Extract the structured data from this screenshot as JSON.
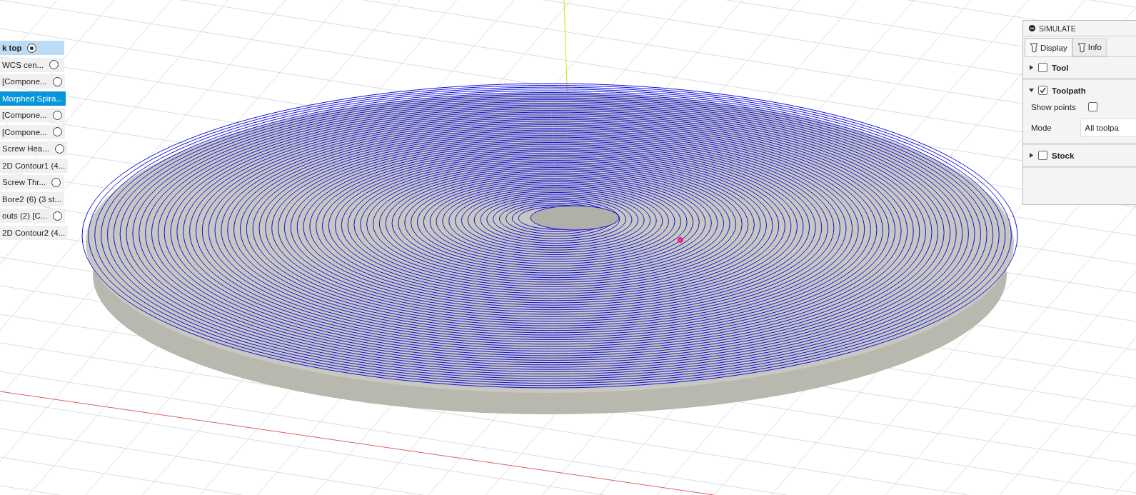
{
  "setup_list": [
    {
      "label": "k top",
      "kind": "radio",
      "checked": true,
      "selected": false,
      "highlighted": true
    },
    {
      "label": "WCS cen...",
      "kind": "radio",
      "checked": false,
      "selected": false,
      "highlighted": false
    },
    {
      "label": "[Compone...",
      "kind": "radio",
      "checked": false,
      "selected": false,
      "highlighted": false
    },
    {
      "label": "Morphed Spira...",
      "kind": "plain",
      "selected": true,
      "highlighted": false
    },
    {
      "label": "[Compone...",
      "kind": "radio",
      "checked": false,
      "selected": false,
      "highlighted": false
    },
    {
      "label": "[Compone...",
      "kind": "radio",
      "checked": false,
      "selected": false,
      "highlighted": false
    },
    {
      "label": "Screw Hea...",
      "kind": "radio",
      "checked": false,
      "selected": false,
      "highlighted": false
    },
    {
      "label": "2D Contour1 (4...",
      "kind": "plain",
      "selected": false,
      "highlighted": false
    },
    {
      "label": "Screw Thr...",
      "kind": "radio",
      "checked": false,
      "selected": false,
      "highlighted": false
    },
    {
      "label": "Bore2 (6) (3 st...",
      "kind": "plain",
      "selected": false,
      "highlighted": false
    },
    {
      "label": "outs (2) [C...",
      "kind": "radio",
      "checked": false,
      "selected": false,
      "highlighted": false
    },
    {
      "label": "2D Contour2 (4...",
      "kind": "plain",
      "selected": false,
      "highlighted": false
    }
  ],
  "simulate_panel": {
    "title": "SIMULATE",
    "tabs": [
      {
        "label": "Display",
        "selected": true
      },
      {
        "label": "Info",
        "selected": false
      }
    ],
    "sections": [
      {
        "label": "Tool",
        "checked": false,
        "expanded": false
      },
      {
        "label": "Toolpath",
        "checked": true,
        "expanded": true,
        "show_points_label": "Show points",
        "show_points": false,
        "mode_label": "Mode",
        "mode_value": "All toolpa"
      },
      {
        "label": "Stock",
        "checked": false,
        "expanded": false
      }
    ]
  }
}
